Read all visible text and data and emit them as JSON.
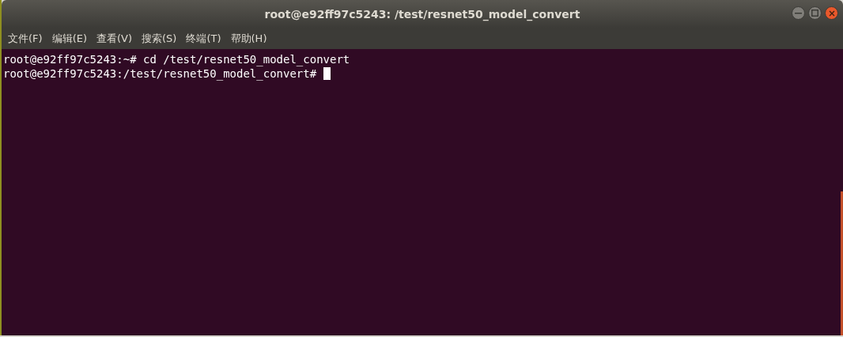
{
  "window": {
    "title": "root@e92ff97c5243: /test/resnet50_model_convert"
  },
  "menu": [
    {
      "label": "文件(F)"
    },
    {
      "label": "编辑(E)"
    },
    {
      "label": "查看(V)"
    },
    {
      "label": "搜索(S)"
    },
    {
      "label": "终端(T)"
    },
    {
      "label": "帮助(H)"
    }
  ],
  "terminal": {
    "lines": [
      "root@e92ff97c5243:~# cd /test/resnet50_model_convert",
      "root@e92ff97c5243:/test/resnet50_model_convert# "
    ],
    "cursor": true
  }
}
